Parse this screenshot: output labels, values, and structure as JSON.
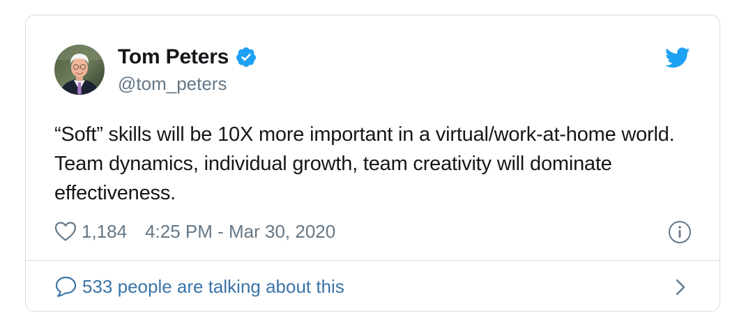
{
  "author": {
    "name": "Tom Peters",
    "handle": "@tom_peters",
    "verified": true
  },
  "tweet": {
    "text": "“Soft” skills will be 10X more important in a virtual/work-at-home world. Team dynamics, individual growth, team creativity will dominate effectiveness.",
    "likes": "1,184",
    "timestamp": "4:25 PM - Mar 30, 2020"
  },
  "conversation": {
    "label": "533 people are talking about this"
  },
  "icons": {
    "brand": "twitter-bird-icon",
    "verified": "verified-badge-icon",
    "like": "heart-icon",
    "info": "info-icon",
    "reply": "speech-bubble-icon",
    "more": "chevron-right-icon"
  },
  "colors": {
    "brand_blue": "#1da1f2",
    "text_primary": "#14171a",
    "text_secondary": "#657786",
    "link": "#3b74a8",
    "border": "#d9dde1"
  }
}
